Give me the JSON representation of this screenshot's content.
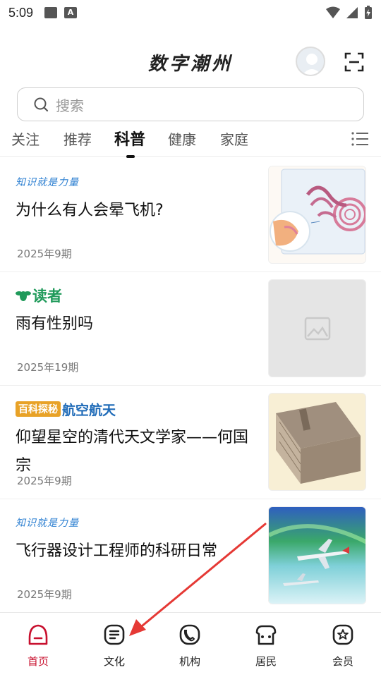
{
  "status_bar": {
    "time": "5:09",
    "badge_letter": "A"
  },
  "header": {
    "title": "数字潮州"
  },
  "search": {
    "placeholder": "搜索"
  },
  "tabs": [
    {
      "label": "关注"
    },
    {
      "label": "推荐"
    },
    {
      "label": "科普",
      "active": true
    },
    {
      "label": "健康"
    },
    {
      "label": "家庭"
    }
  ],
  "articles": [
    {
      "source": "知识就是力量",
      "title": "为什么有人会晕飞机?",
      "date": "2025年9期",
      "thumb_icon": "ear-anatomy-illustration"
    },
    {
      "source": "读者",
      "title": "雨有性别吗",
      "date": "2025年19期",
      "thumb_icon": "image-placeholder-icon"
    },
    {
      "source_tag": "百科探秘",
      "source_sub": "航空航天",
      "title": "仰望星空的清代天文学家——何国宗",
      "date": "2025年9期",
      "thumb_icon": "ancient-book-stack"
    },
    {
      "source": "知识就是力量",
      "title": "飞行器设计工程师的科研日常",
      "date": "2025年9期",
      "thumb_icon": "airplanes-aurora"
    }
  ],
  "bottom_nav": [
    {
      "label": "首页",
      "icon": "home-icon",
      "active": true
    },
    {
      "label": "文化",
      "icon": "document-icon"
    },
    {
      "label": "机构",
      "icon": "phone-icon"
    },
    {
      "label": "居民",
      "icon": "house-icon"
    },
    {
      "label": "会员",
      "icon": "star-badge-icon"
    }
  ],
  "colors": {
    "accent": "#c8102e",
    "annotation_arrow": "#e53935"
  }
}
